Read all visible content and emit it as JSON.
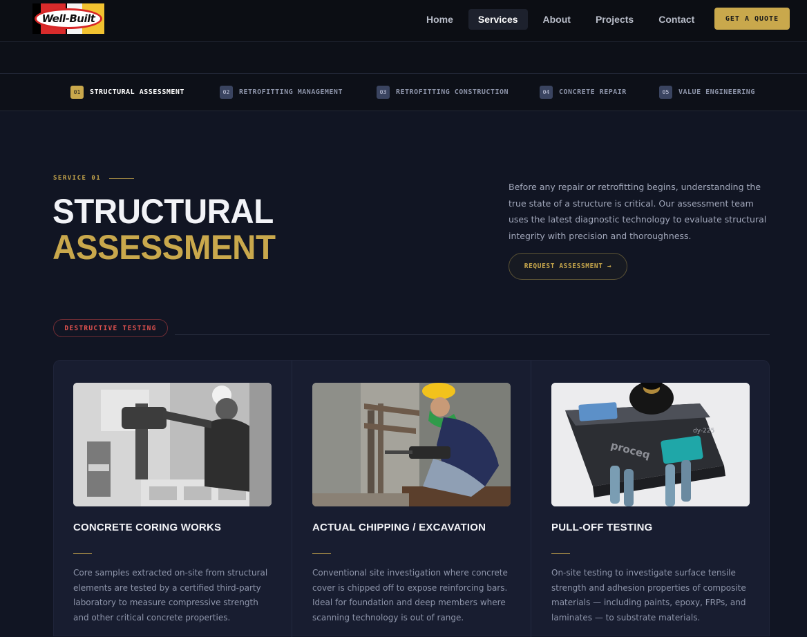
{
  "brand": {
    "logo_text": "Well-Built"
  },
  "nav": {
    "items": [
      {
        "label": "Home"
      },
      {
        "label": "Services"
      },
      {
        "label": "About"
      },
      {
        "label": "Projects"
      },
      {
        "label": "Contact"
      }
    ],
    "active": "Services",
    "cta": "GET A QUOTE"
  },
  "service_tabs": [
    {
      "num": "01",
      "label": "STRUCTURAL ASSESSMENT"
    },
    {
      "num": "02",
      "label": "RETROFITTING MANAGEMENT"
    },
    {
      "num": "03",
      "label": "RETROFITTING CONSTRUCTION"
    },
    {
      "num": "04",
      "label": "CONCRETE REPAIR"
    },
    {
      "num": "05",
      "label": "VALUE ENGINEERING"
    }
  ],
  "hero": {
    "eyebrow": "SERVICE 01",
    "title_line1": "STRUCTURAL",
    "title_line2": "ASSESSMENT",
    "intro": "Before any repair or retrofitting begins, understanding the true state of a structure is critical. Our assessment team uses the latest diagnostic technology to evaluate structural integrity with precision and thoroughness.",
    "button": "REQUEST ASSESSMENT →"
  },
  "category": {
    "label": "DESTRUCTIVE TESTING"
  },
  "cards": [
    {
      "title": "CONCRETE CORING WORKS",
      "text": "Core samples extracted on-site from structural elements are tested by a certified third-party laboratory to measure compressive strength and other critical concrete properties."
    },
    {
      "title": "ACTUAL CHIPPING / EXCAVATION",
      "text": "Conventional site investigation where concrete cover is chipped off to expose reinforcing bars. Ideal for foundation and deep members where scanning technology is out of range."
    },
    {
      "title": "PULL-OFF TESTING",
      "text": "On-site testing to investigate surface tensile strength and adhesion properties of composite materials — including paints, epoxy, FRPs, and laminates — to substrate materials.",
      "device_brand": "proceq",
      "device_model": "dy-225"
    }
  ],
  "colors": {
    "gold": "#c9a84c",
    "background": "#111523",
    "card_panel": "#181d30",
    "category_red": "#e0524f"
  }
}
